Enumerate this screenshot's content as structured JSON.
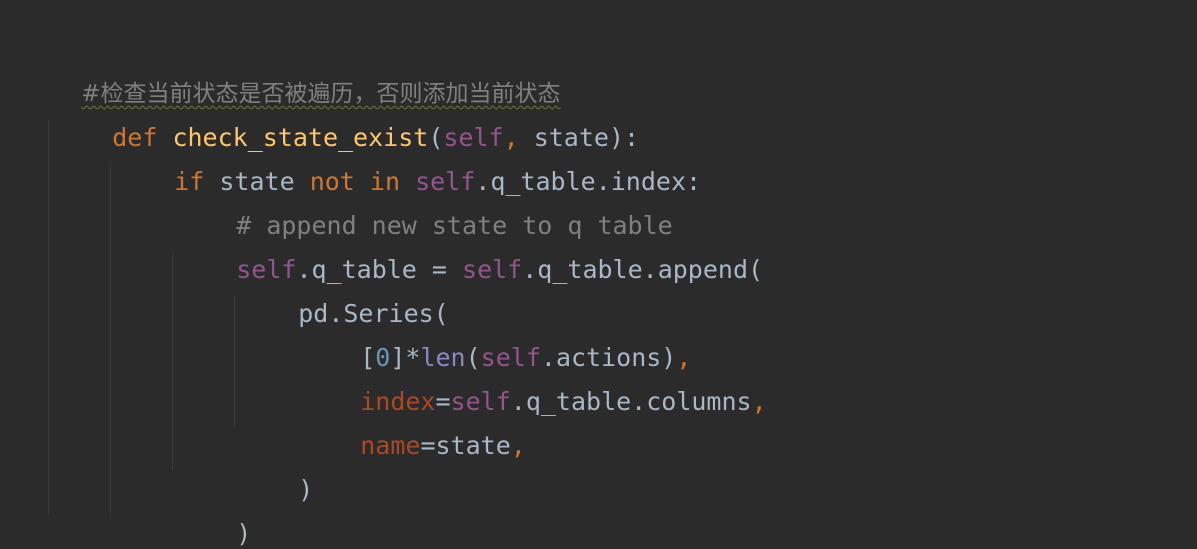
{
  "editor": {
    "lines": {
      "l1": {
        "comment": "#检查当前状态是否被遍历，否则添加当前状态"
      },
      "l2": {
        "def": "def",
        "fname": "check_state_exist",
        "open": "(",
        "self": "self",
        "comma": ",",
        "param": " state",
        "close": "):"
      },
      "l3": {
        "if": "if",
        "state": " state ",
        "not": "not",
        "sp": " ",
        "in": "in",
        "sp2": " ",
        "self": "self",
        "rest": ".q_table.index:"
      },
      "l4": {
        "comment": "# append new state to q table"
      },
      "l5": {
        "self1": "self",
        "mid": ".q_table = ",
        "self2": "self",
        "rest": ".q_table.append("
      },
      "l6": {
        "text": "pd.Series("
      },
      "l7": {
        "open": "[",
        "zero": "0",
        "mid": "]*",
        "len": "len",
        "paren": "(",
        "self": "self",
        "rest": ".actions)",
        "comma": ","
      },
      "l8": {
        "kw": "index",
        "eq": "=",
        "self": "self",
        "rest": ".q_table.columns",
        "comma": ","
      },
      "l9": {
        "kw": "name",
        "eq": "=state",
        "comma": ","
      },
      "l10": {
        "text": ")"
      },
      "l11": {
        "text": ")"
      }
    }
  }
}
